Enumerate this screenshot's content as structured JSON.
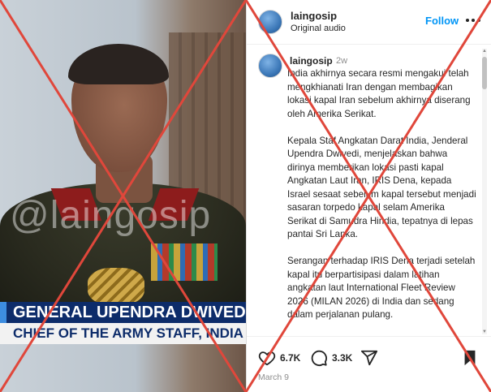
{
  "media": {
    "watermark": "@laingosip",
    "lower_third_name": "GENERAL UPENDRA DWIVEDI,",
    "lower_third_title": "CHIEF OF THE ARMY STAFF, INDIA"
  },
  "header": {
    "username": "laingosip",
    "audio": "Original audio",
    "follow_label": "Follow",
    "more_icon": "more-horizontal-icon"
  },
  "caption": {
    "username": "laingosip",
    "time_ago": "2w",
    "paragraphs": [
      "India akhirnya secara resmi mengakui telah mengkhianati Iran dengan membagikan lokasi kapal Iran sebelum akhirnya diserang oleh Amerika Serikat.",
      "Kepala Staf Angkatan Darat India, Jenderal Upendra Dwivedi, menjelaskan bahwa dirinya memberikan lokasi pasti kapal Angkatan Laut Iran, IRIS Dena, kepada Israel sesaat sebelum kapal tersebut menjadi sasaran torpedo kapal selam Amerika Serikat di Samudra Hindia, tepatnya di lepas pantai Sri Lanka.",
      "Serangan terhadap IRIS Dena terjadi setelah kapal itu berpartisipasi dalam latihan angkatan laut International Fleet Review 2026 (MILAN 2026) di India dan sedang dalam perjalanan pulang."
    ]
  },
  "actions": {
    "likes": "6.7K",
    "comments": "3.3K",
    "date": "March 9",
    "icons": [
      "heart-icon",
      "comment-icon",
      "share-icon",
      "bookmark-icon"
    ]
  },
  "colors": {
    "follow": "#0095f6",
    "cross": "#e0473b",
    "lower_third_bg": "#0d2c6a"
  }
}
